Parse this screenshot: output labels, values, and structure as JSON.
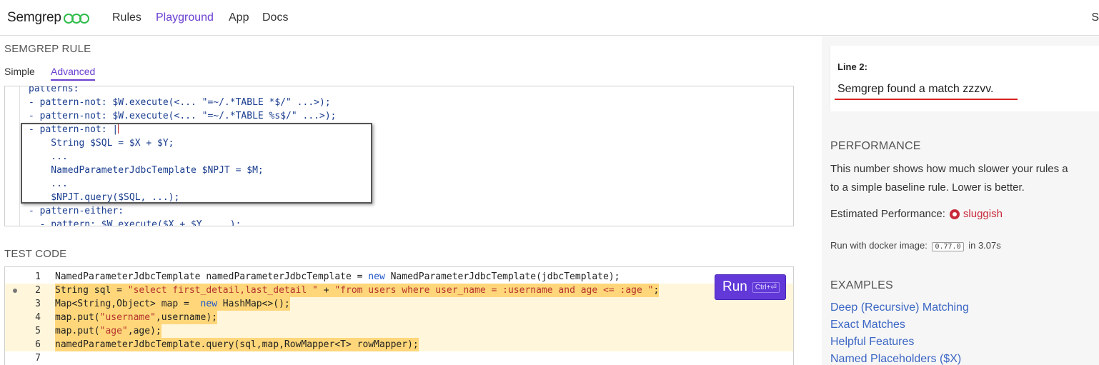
{
  "nav": {
    "logo_text": "Semgrep",
    "links": [
      "Rules",
      "Playground",
      "App",
      "Docs"
    ],
    "active": "Playground",
    "right_text": "S"
  },
  "rule_section": {
    "title": "SEMGREP RULE",
    "tabs": [
      "Simple",
      "Advanced"
    ],
    "active_tab": "Advanced",
    "lines": [
      "patterns:",
      "- pattern-not: $W.execute(<... \"=~/.*TABLE *$/\" ...>);",
      "- pattern-not: $W.execute(<... \"=~/.*TABLE %s$/\" ...>);",
      "- pattern-not: |",
      "    String $SQL = $X + $Y;",
      "    ...",
      "    NamedParameterJdbcTemplate $NPJT = $M;",
      "    ...",
      "    $NPJT.query($SQL, ...);",
      "- pattern-either:",
      "  - pattern: $W.execute($X + $Y, ...);"
    ]
  },
  "test_section": {
    "title": "TEST CODE",
    "run_label": "Run",
    "run_shortcut": "Ctrl+⏎",
    "line_numbers": [
      "1",
      "2",
      "3",
      "4",
      "5",
      "6",
      "7"
    ],
    "lines": [
      "NamedParameterJdbcTemplate namedParameterJdbcTemplate = new NamedParameterJdbcTemplate(jdbcTemplate);",
      "String sql = \"select first_detail,last_detail \" + \"from users where user_name = :username and age <= :age \";",
      "Map<String,Object> map =  new HashMap<>();",
      "map.put(\"username\",username);",
      "map.put(\"age\",age);",
      "namedParameterJdbcTemplate.query(sql,map,RowMapper<T> rowMapper);",
      ""
    ]
  },
  "results": {
    "line_label": "Line 2:",
    "message": "Semgrep found a match zzzvv."
  },
  "performance": {
    "title": "PERFORMANCE",
    "desc_line1": "This number shows how much slower your rules a",
    "desc_line2": "to a simple baseline rule. Lower is better.",
    "estimated_label": "Estimated Performance:",
    "estimated_value": "sluggish",
    "docker_prefix": "Run with docker image:",
    "docker_version": "0.77.0",
    "docker_suffix": "in 3.07s"
  },
  "examples": {
    "title": "EXAMPLES",
    "items": [
      "Deep (Recursive) Matching",
      "Exact Matches",
      "Helpful Features",
      "Named Placeholders ($X)"
    ]
  },
  "colors": {
    "accent": "#6a3fd1",
    "run_button": "#6238d8",
    "highlight": "#ffd77a",
    "link": "#3b66c4",
    "warning": "#c82b3a"
  }
}
